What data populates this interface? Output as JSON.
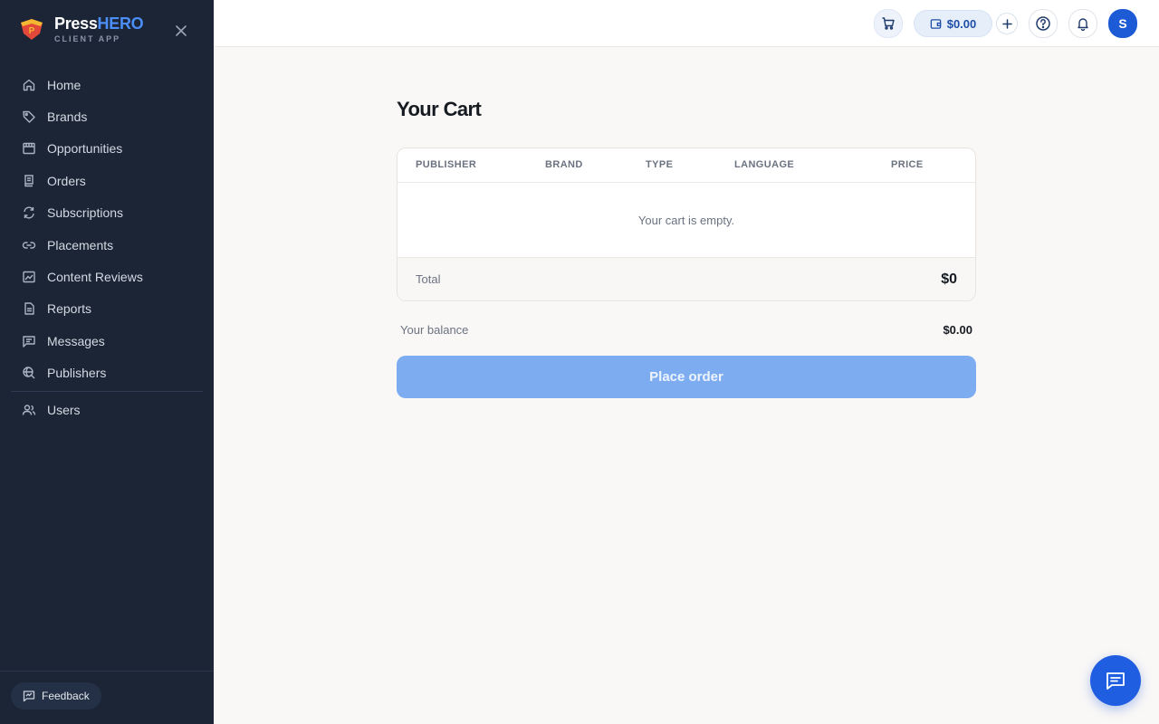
{
  "brand": {
    "name_part1": "Press",
    "name_part2": "HERO",
    "subtitle": "CLIENT APP"
  },
  "sidebar": {
    "items": [
      {
        "label": "Home",
        "icon": "home-icon"
      },
      {
        "label": "Brands",
        "icon": "tag-icon"
      },
      {
        "label": "Opportunities",
        "icon": "storefront-icon"
      },
      {
        "label": "Orders",
        "icon": "receipt-icon"
      },
      {
        "label": "Subscriptions",
        "icon": "refresh-icon"
      },
      {
        "label": "Placements",
        "icon": "link-icon"
      },
      {
        "label": "Content Reviews",
        "icon": "image-review-icon"
      },
      {
        "label": "Reports",
        "icon": "document-icon"
      },
      {
        "label": "Messages",
        "icon": "message-icon"
      },
      {
        "label": "Publishers",
        "icon": "globe-search-icon"
      }
    ],
    "secondary_items": [
      {
        "label": "Users",
        "icon": "users-icon"
      }
    ],
    "feedback_label": "Feedback"
  },
  "topbar": {
    "wallet_balance": "$0.00",
    "avatar_initial": "S"
  },
  "cart": {
    "title": "Your Cart",
    "columns": [
      "PUBLISHER",
      "BRAND",
      "TYPE",
      "LANGUAGE",
      "PRICE"
    ],
    "empty_message": "Your cart is empty.",
    "total_label": "Total",
    "total_value": "$0",
    "balance_label": "Your balance",
    "balance_value": "$0.00",
    "place_order_label": "Place order"
  },
  "colors": {
    "sidebar_bg": "#1b2536",
    "accent": "#1f5ee0",
    "button_disabled": "#7dadf0"
  }
}
